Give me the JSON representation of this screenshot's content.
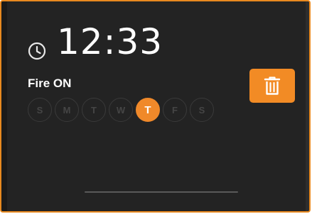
{
  "alarm": {
    "time": "12:33",
    "label": "Fire ON",
    "days": [
      {
        "letter": "S",
        "active": false
      },
      {
        "letter": "M",
        "active": false
      },
      {
        "letter": "T",
        "active": false
      },
      {
        "letter": "W",
        "active": false
      },
      {
        "letter": "T",
        "active": true
      },
      {
        "letter": "F",
        "active": false
      },
      {
        "letter": "S",
        "active": false
      }
    ]
  },
  "icons": {
    "clock": "clock-icon",
    "delete": "trash-icon"
  },
  "colors": {
    "accent": "#f28b25",
    "background": "#232323",
    "border": "#e8891f",
    "text": "#ffffff",
    "inactive_day": "#454545"
  }
}
